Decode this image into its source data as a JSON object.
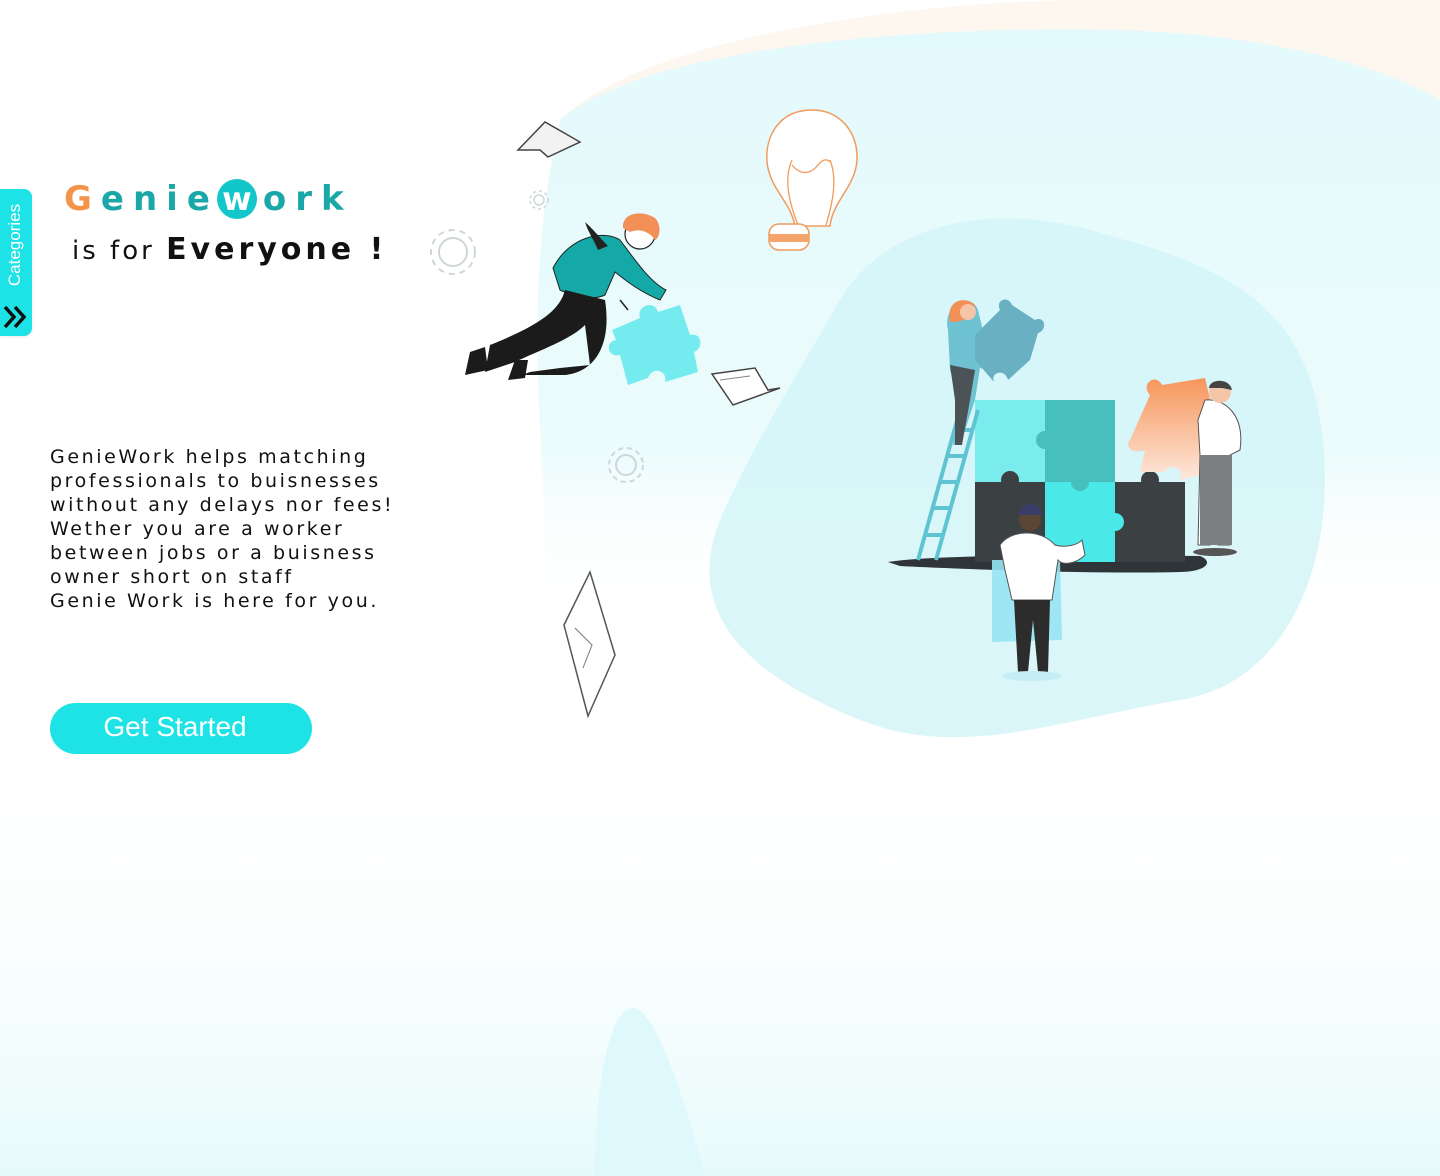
{
  "sidebar": {
    "label": "Categories",
    "icon": "double-chevron-right-icon"
  },
  "brand": {
    "g": "G",
    "enie": "enie",
    "w": "w",
    "ork": "ork",
    "colors": {
      "orange": "#f3944a",
      "teal": "#1aa7a7",
      "cyan": "#13c6c9"
    }
  },
  "tagline": {
    "prefix": "is for",
    "emphasis": "Everyone !"
  },
  "description": {
    "lines": [
      "GenieWork helps matching",
      "professionals to buisnesses",
      "without any delays nor fees!",
      "Wether you are a worker",
      "between jobs or a buisness",
      "owner short on staff",
      "Genie Work is here for you."
    ]
  },
  "cta": {
    "label": "Get Started",
    "color": "#1ee3e6"
  },
  "illustration": {
    "icons": [
      "lightbulb-icon",
      "gear-icon",
      "puzzle-icon",
      "paper-icon",
      "laptop-icon"
    ]
  }
}
